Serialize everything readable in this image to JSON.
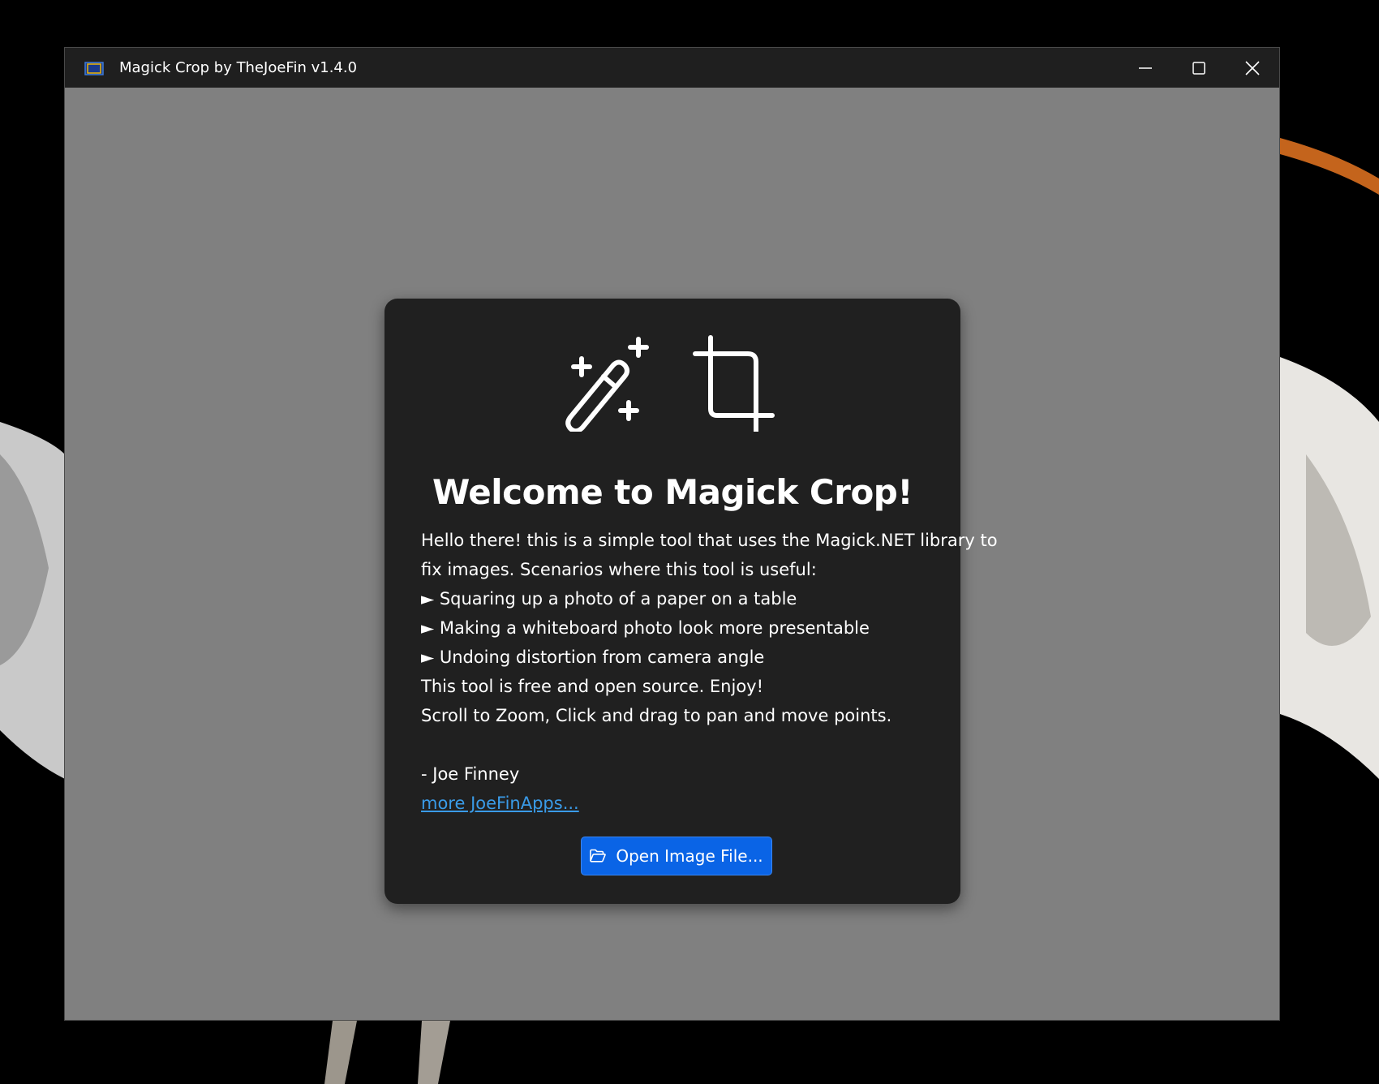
{
  "window": {
    "title": "Magick Crop by TheJoeFin v1.4.0",
    "controls": {
      "minimize": "minimize-icon",
      "maximize": "maximize-icon",
      "close": "close-icon"
    }
  },
  "welcome": {
    "icons": [
      "magic-wand-icon",
      "crop-icon"
    ],
    "title": "Welcome to Magick Crop!",
    "intro_line1": "Hello there! this is a simple tool that uses the Magick.NET library to",
    "intro_line2": "fix images. Scenarios where this tool is useful:",
    "bullets": [
      "► Squaring up a photo of a paper on a table",
      "► Making a whiteboard photo look more presentable",
      "► Undoing distortion from camera angle"
    ],
    "free_text": "This tool is free and open source. Enjoy!",
    "instructions": "Scroll to Zoom, Click and drag to pan and move points.",
    "signature": "- Joe Finney",
    "link_text": "more JoeFinApps...",
    "open_button_label": "Open Image File...",
    "open_button_icon": "folder-open-icon"
  },
  "colors": {
    "titlebar": "#1f1f1f",
    "canvas": "#808080",
    "card": "#202020",
    "accent_button": "#0a64e6",
    "link": "#3a9be8"
  }
}
